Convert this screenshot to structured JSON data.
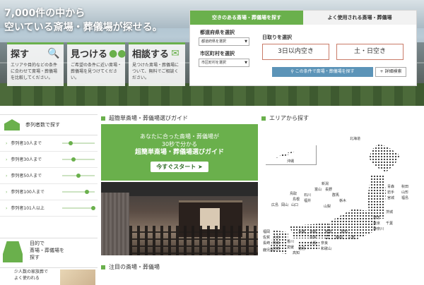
{
  "hero": {
    "title_line1": "7,000件の中から",
    "title_line2": "空いている斎場・葬儀場が探せる。",
    "steps": [
      {
        "label": "探す",
        "icon": "magnifier-icon",
        "desc": "エリアや目的などの条件に合わせて斎場・葬儀場を比較してください。"
      },
      {
        "label": "見つける",
        "icon": "footprints-icon",
        "desc": "ご希望の条件に近い斎場・葬儀場を見つけてください。"
      },
      {
        "label": "相談する",
        "icon": "mail-icon",
        "desc": "見つけた斎場・葬儀場について、無料でご相談ください。"
      }
    ]
  },
  "search": {
    "tab_active": "空きのある斎場・葬儀場を探す",
    "tab_inactive": "よく使用される斎場・葬儀場",
    "pref_label": "都道府県を選択",
    "pref_select": "都道府県を選択",
    "city_label": "市区町村を選択",
    "city_select": "市区町村を選択",
    "date_label": "日取りを選択",
    "date_btn1": "3日以内空き",
    "date_btn2": "土・日空き",
    "search_btn": "この条件で斎場・葬儀場を探す",
    "detail_btn": "詳細検索"
  },
  "sidebar": {
    "head": "参列者数で探す",
    "items": [
      {
        "label": "参列者10人まで",
        "level": 0.25
      },
      {
        "label": "参列者30人まで",
        "level": 0.35
      },
      {
        "label": "参列者50人まで",
        "level": 0.5
      },
      {
        "label": "参列者100人まで",
        "level": 0.75
      },
      {
        "label": "参列者101人以上",
        "level": 0.95
      }
    ],
    "purpose_line1": "目的で",
    "purpose_line2": "斎場・葬儀場を",
    "purpose_line3": "探す",
    "sub_line1": "少人数の家族葬で",
    "sub_line2": "よく使われる"
  },
  "guide": {
    "section": "超簡単斎場・葬儀場選びガイド",
    "line1": "あなたに合った斎場・葬儀場が",
    "line2": "30秒で分かる",
    "line3": "超簡単斎場・葬儀場選びガイド",
    "button": "今すぐスタート"
  },
  "featured": {
    "section": "注目の斎場・葬儀場"
  },
  "area": {
    "section": "エリアから探す",
    "labels": [
      "北海道",
      "沖縄",
      "青森",
      "秋田",
      "岩手",
      "山形",
      "宮城",
      "福島",
      "新潟",
      "富山",
      "石川",
      "福井",
      "長野",
      "群馬",
      "栃木",
      "茨城",
      "山梨",
      "埼玉",
      "東京",
      "千葉",
      "神奈川",
      "岐阜",
      "静岡",
      "愛知",
      "三重",
      "京都",
      "滋賀",
      "大阪",
      "兵庫",
      "奈良",
      "和歌山",
      "鳥取",
      "島根",
      "岡山",
      "広島",
      "山口",
      "香川",
      "徳島",
      "愛媛",
      "高知",
      "福岡",
      "佐賀",
      "長崎",
      "熊本",
      "大分",
      "宮崎",
      "鹿児島"
    ]
  }
}
